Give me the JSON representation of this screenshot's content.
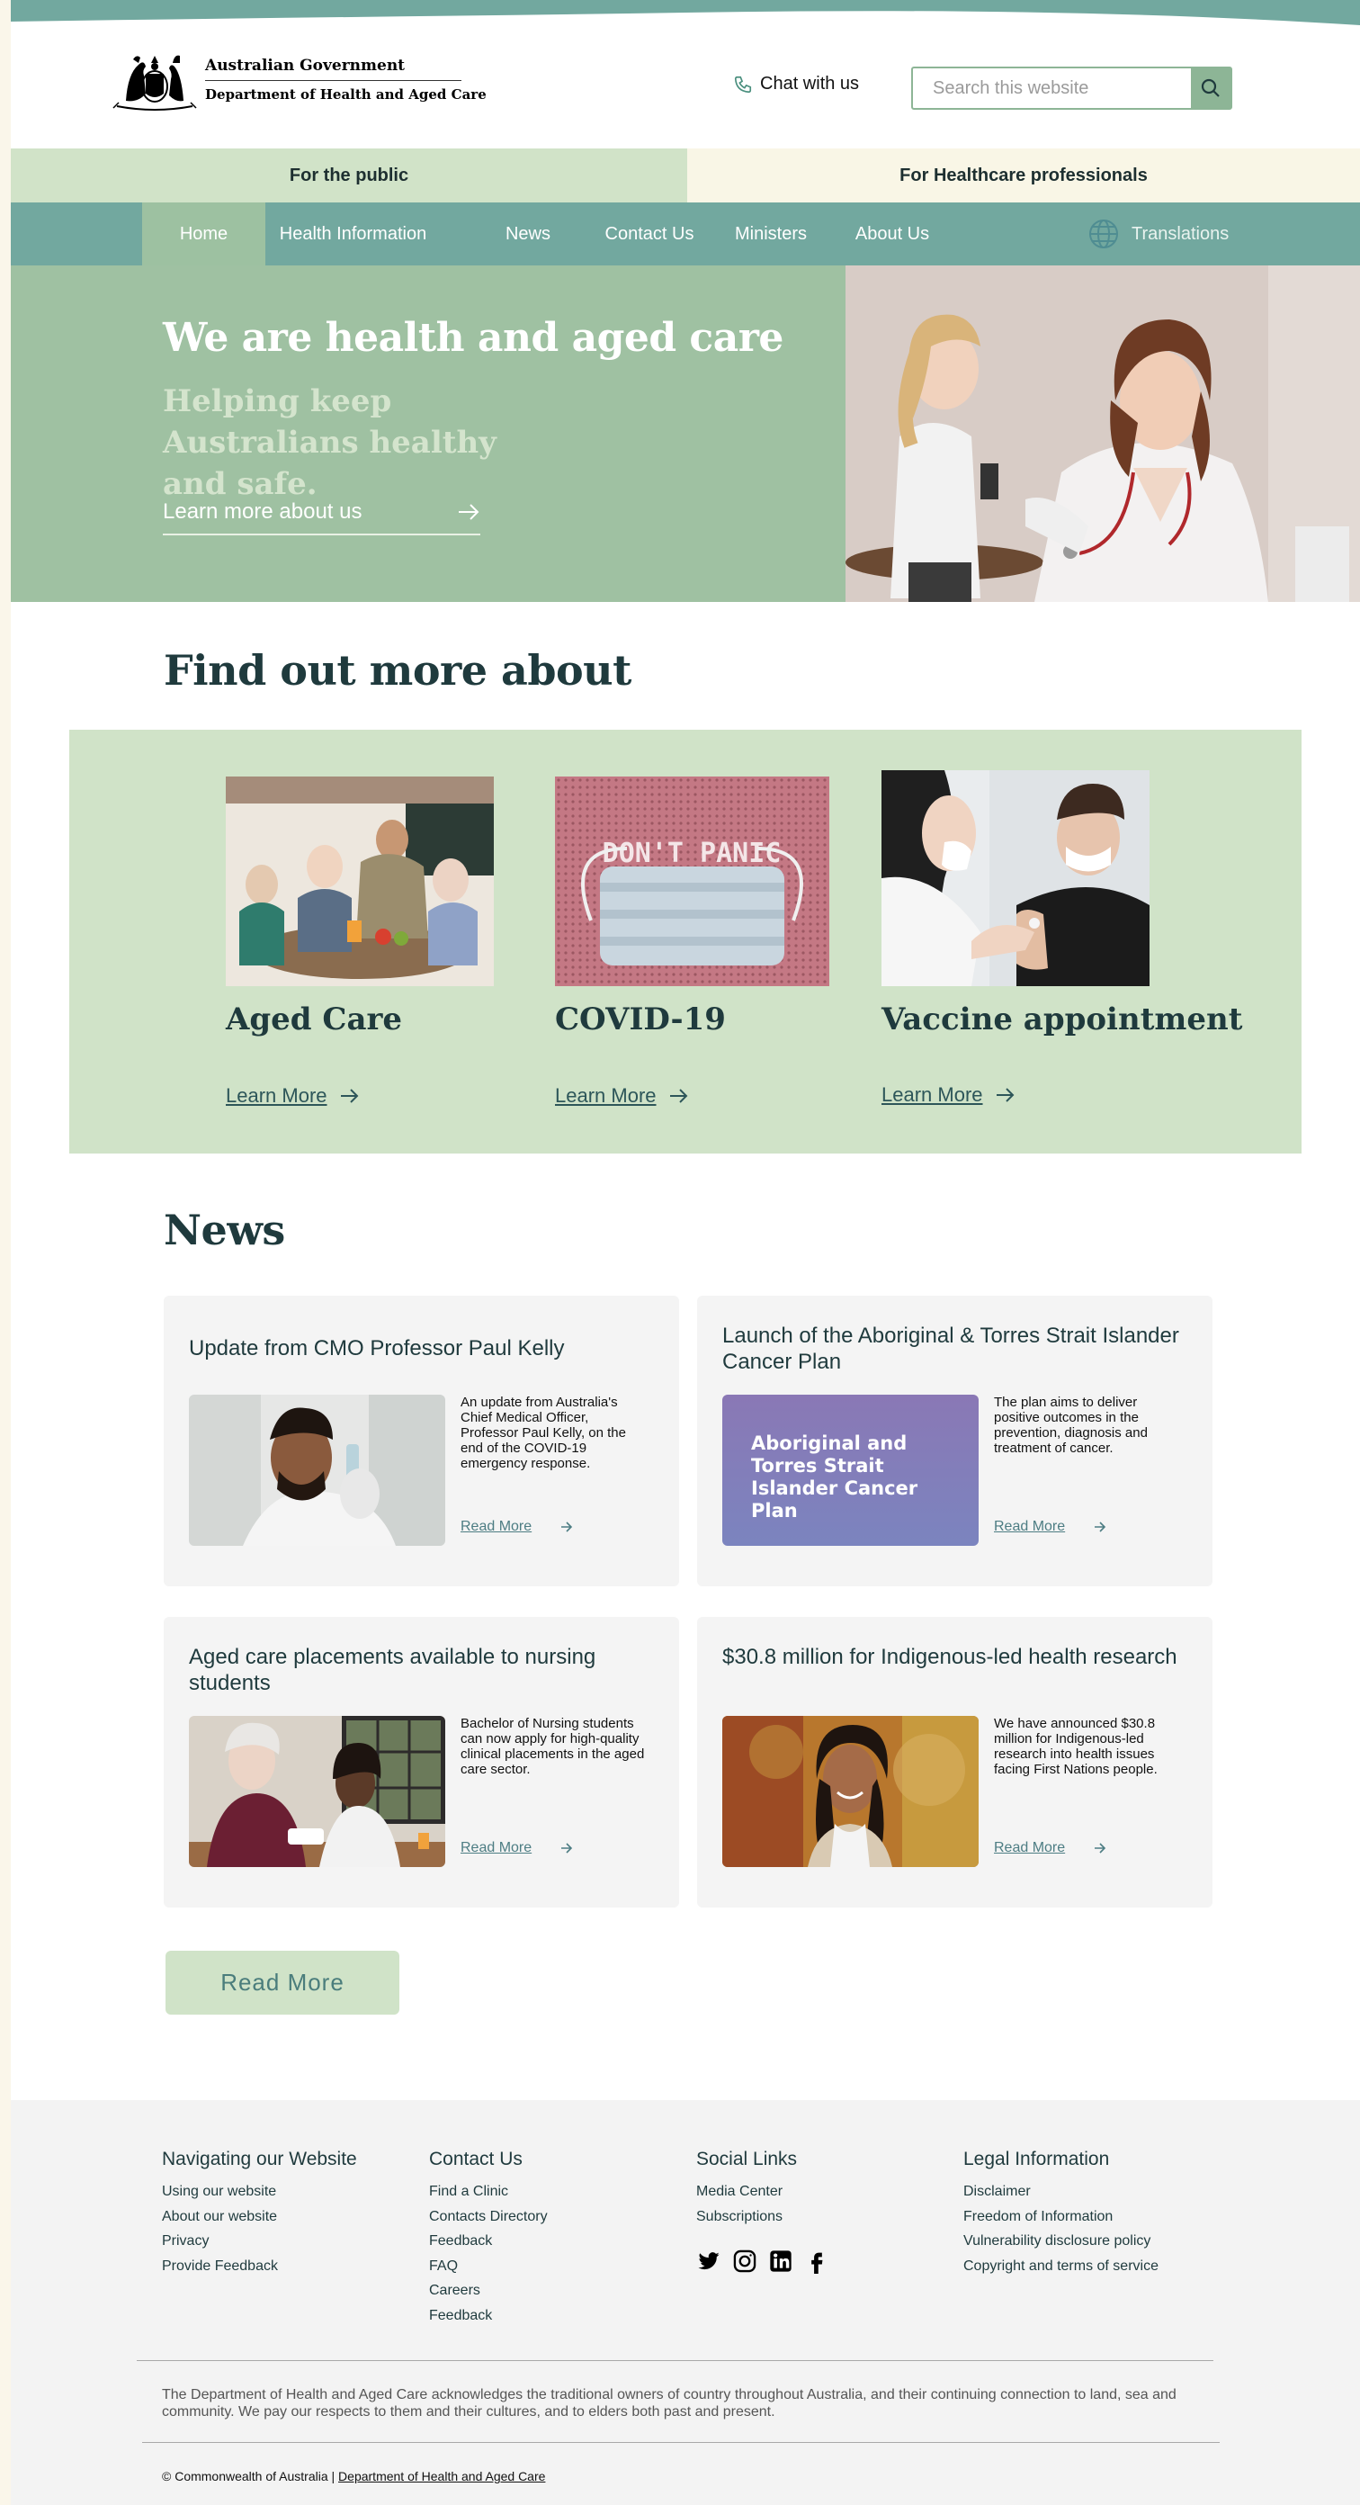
{
  "header": {
    "logo_line1": "Australian Government",
    "logo_line2": "Department of Health and Aged Care",
    "chat_label": "Chat with us",
    "search_placeholder": "Search this website"
  },
  "audience": {
    "public": "For the public",
    "professionals": "For Healthcare professionals"
  },
  "nav": {
    "items": [
      "Home",
      "Health Information",
      "News",
      "Contact Us",
      "Ministers",
      "About Us"
    ],
    "active": "Home",
    "translations": "Translations"
  },
  "hero": {
    "title": "We are health and aged care",
    "subtitle": "Helping keep Australians healthy and safe.",
    "link": "Learn more about us"
  },
  "find": {
    "title": "Find out more about",
    "cards": [
      {
        "title": "Aged Care",
        "link": "Learn More"
      },
      {
        "title": "COVID-19",
        "link": "Learn More"
      },
      {
        "title": "Vaccine  appointment",
        "link": "Learn More"
      }
    ],
    "covid_mask_text": "DON'T PANIC"
  },
  "news": {
    "title": "News",
    "items": [
      {
        "title": "Update from CMO Professor Paul Kelly",
        "text": "An update from Australia's Chief Medical Officer, Professor Paul Kelly, on the end of the COVID-19 emergency response.",
        "link": "Read More"
      },
      {
        "title": "Launch of the Aboriginal & Torres Strait Islander Cancer Plan",
        "text": "The plan aims to deliver positive outcomes in the prevention, diagnosis and treatment of cancer.",
        "link": "Read More",
        "image_text": "Aboriginal and Torres Strait Islander Cancer Plan"
      },
      {
        "title": "Aged care placements available to nursing students",
        "text": "Bachelor of Nursing students can now apply for high-quality clinical placements in the aged care sector.",
        "link": "Read More"
      },
      {
        "title": "$30.8 million for Indigenous-led health research",
        "text": "We have announced $30.8 million for Indigenous-led research into health issues facing First Nations people.",
        "link": "Read More"
      }
    ],
    "more_button": "Read More"
  },
  "footer": {
    "nav_title": "Navigating our Website",
    "nav_links": [
      "Using our website",
      "About our website",
      "Privacy",
      "Provide Feedback"
    ],
    "contact_title": "Contact Us",
    "contact_links": [
      "Find a Clinic",
      "Contacts Directory",
      "Feedback",
      "FAQ",
      "Careers",
      "Feedback"
    ],
    "social_title": "Social Links",
    "social_links": [
      "Media Center",
      "Subscriptions"
    ],
    "legal_title": "Legal Information",
    "legal_links": [
      "Disclaimer",
      "Freedom of Information",
      "Vulnerability disclosure policy",
      "Copyright and terms of service"
    ],
    "acknowledgement": "The Department of Health and Aged Care acknowledges the traditional owners of country throughout Australia, and their continuing connection to land, sea and community. We pay our respects to them and their cultures, and to elders both past and present.",
    "copyright": "© Commonwealth of Australia |",
    "copyright_link": "Department of Health and Aged Care"
  },
  "colors": {
    "nav_bg": "#72a89f",
    "hero_bg": "#9fc1a2",
    "panel_bg": "#d0e3c8",
    "heading": "#1f3a3d",
    "footer_bg": "#f3f3f3"
  }
}
